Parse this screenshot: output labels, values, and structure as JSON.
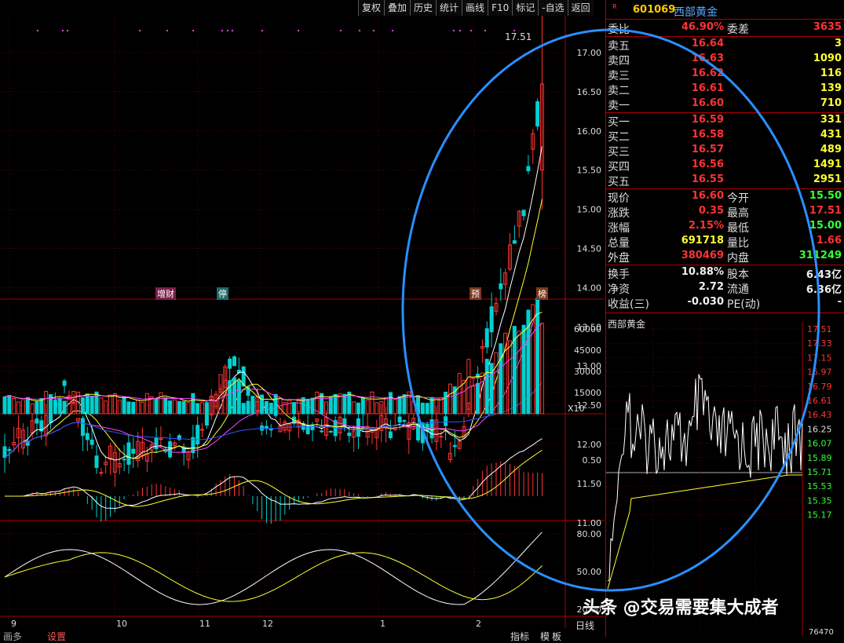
{
  "toolbar": [
    "复权",
    "叠加",
    "历史",
    "统计",
    "画线",
    "F10",
    "标记",
    "-自选",
    "返回"
  ],
  "quote": {
    "marker": "R",
    "code": "601069",
    "name": "西部黄金",
    "weibi_label": "委比",
    "weibi": "46.90%",
    "weicha_label": "委差",
    "weicha": "3635",
    "sell": [
      {
        "label": "卖五",
        "price": "16.64",
        "vol": "3"
      },
      {
        "label": "卖四",
        "price": "16.63",
        "vol": "1090"
      },
      {
        "label": "卖三",
        "price": "16.62",
        "vol": "116"
      },
      {
        "label": "卖二",
        "price": "16.61",
        "vol": "139"
      },
      {
        "label": "卖一",
        "price": "16.60",
        "vol": "710"
      }
    ],
    "buy": [
      {
        "label": "买一",
        "price": "16.59",
        "vol": "331"
      },
      {
        "label": "买二",
        "price": "16.58",
        "vol": "431"
      },
      {
        "label": "买三",
        "price": "16.57",
        "vol": "489"
      },
      {
        "label": "买四",
        "price": "16.56",
        "vol": "1491"
      },
      {
        "label": "买五",
        "price": "16.55",
        "vol": "2951"
      }
    ],
    "stats": [
      {
        "l1": "现价",
        "v1": "16.60",
        "c1": "red",
        "l2": "今开",
        "v2": "15.50",
        "c2": "grn"
      },
      {
        "l1": "涨跌",
        "v1": "0.35",
        "c1": "red",
        "l2": "最高",
        "v2": "17.51",
        "c2": "red"
      },
      {
        "l1": "涨幅",
        "v1": "2.15%",
        "c1": "red",
        "l2": "最低",
        "v2": "15.00",
        "c2": "grn"
      },
      {
        "l1": "总量",
        "v1": "691718",
        "c1": "yel",
        "l2": "量比",
        "v2": "1.66",
        "c2": "red"
      },
      {
        "l1": "外盘",
        "v1": "380469",
        "c1": "red",
        "l2": "内盘",
        "v2": "311249",
        "c2": "grn"
      }
    ],
    "fin": [
      {
        "l1": "换手",
        "v1": "10.88%",
        "l2": "股本",
        "v2": "6.43亿"
      },
      {
        "l1": "净资",
        "v1": "2.72",
        "l2": "流通",
        "v2": "6.36亿"
      },
      {
        "l1": "收益(三)",
        "v1": "-0.030",
        "l2": "PE(动)",
        "v2": "-"
      }
    ],
    "intraday_title": "西部黄金",
    "intraday_axis": [
      "17.51",
      "17.33",
      "17.15",
      "16.97",
      "16.79",
      "16.61",
      "16.43",
      "16.25",
      "16.07",
      "15.89",
      "15.71",
      "15.53",
      "15.35",
      "15.17"
    ],
    "intraday_bottom": "76470"
  },
  "main_chart": {
    "price_axis": [
      "17.00",
      "16.50",
      "16.00",
      "15.50",
      "15.00",
      "14.50",
      "14.00",
      "13.50",
      "13.00",
      "12.50",
      "12.00",
      "11.50",
      "11.00"
    ],
    "high_label": "17.51",
    "tags": [
      "增财",
      "停",
      "预",
      "榜"
    ],
    "vol_axis": [
      "60000",
      "45000",
      "30000",
      "15000"
    ],
    "vol_unit": "X10",
    "macd_axis": [
      "0.50"
    ],
    "kdj_axis": [
      "80.00",
      "50.00",
      "20.00"
    ],
    "months": [
      "9",
      "10",
      "11",
      "12",
      "1",
      "2"
    ],
    "bottom_tabs": [
      "画多",
      "设置",
      "指标",
      "模",
      "板",
      "日线"
    ]
  },
  "watermark": "头条 @交易需要集大成者",
  "colors": {
    "up": "#ff3333",
    "down": "#00d0d0",
    "ma5": "#ffffff",
    "ma10": "#ffff33",
    "ma20": "#ff44ff",
    "ma60": "#3355ff",
    "circle": "#2a8fff"
  }
}
